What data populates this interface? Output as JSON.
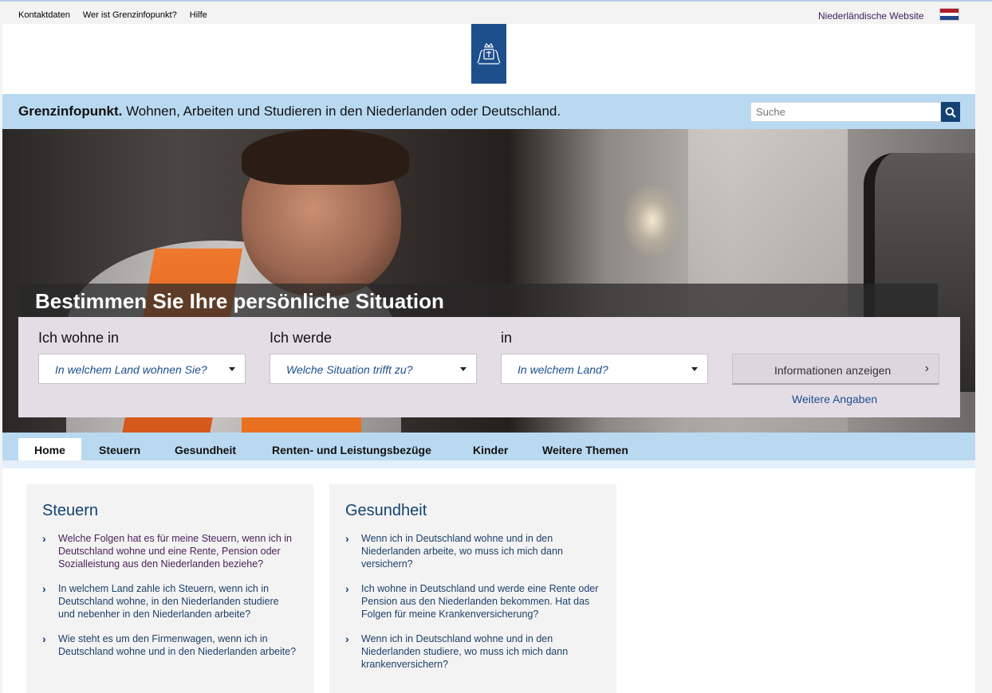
{
  "topbar": {
    "links": [
      "Kontaktdaten",
      "Wer ist Grenzinfopunkt?",
      "Hilfe"
    ],
    "nl_link": "Niederländische Website"
  },
  "colors": {
    "brand_blue": "#154273",
    "light_blue": "#b9d9f0",
    "selector_bg": "#e4dde6",
    "flag_red": "#ae1c28",
    "flag_white": "#ffffff",
    "flag_blue": "#21468b"
  },
  "header": {
    "site_name": "Grenzinfopunkt.",
    "tagline": "Wohnen, Arbeiten und Studieren in den Niederlanden oder Deutschland.",
    "search_placeholder": "Suche"
  },
  "hero": {
    "title": "Bestimmen Sie Ihre persönliche Situation",
    "fields": [
      {
        "label": "Ich wohne in",
        "value": "In welchem Land wohnen Sie?"
      },
      {
        "label": "Ich werde",
        "value": "Welche Situation trifft zu?"
      },
      {
        "label": "in",
        "value": "In welchem Land?"
      }
    ],
    "submit_label": "Informationen anzeigen",
    "more_link": "Weitere Angaben"
  },
  "nav": {
    "items": [
      "Home",
      "Steuern",
      "Gesundheit",
      "Renten- und Leistungsbezüge",
      "Kinder",
      "Weitere Themen"
    ]
  },
  "cards": [
    {
      "title": "Steuern",
      "items": [
        "Welche Folgen hat es für meine Steuern, wenn ich in Deutschland wohne und eine Rente, Pension oder Sozialleistung aus den Niederlanden beziehe?",
        "In welchem Land zahle ich Steuern, wenn ich in Deutschland wohne, in den Niederlanden studiere und nebenher in den Niederlanden arbeite?",
        "Wie steht es um den Firmenwagen, wenn ich in Deutschland wohne und in den Niederlanden arbeite?"
      ]
    },
    {
      "title": "Gesundheit",
      "items": [
        "Wenn ich in Deutschland wohne und in den Niederlanden arbeite, wo muss ich mich dann versichern?",
        "Ich wohne in Deutschland und werde eine Rente oder Pension aus den Niederlanden bekommen. Hat das Folgen für meine Krankenversicherung?",
        "Wenn ich in Deutschland wohne und in den Niederlanden studiere, wo muss ich mich dann krankenversichern?"
      ]
    }
  ]
}
